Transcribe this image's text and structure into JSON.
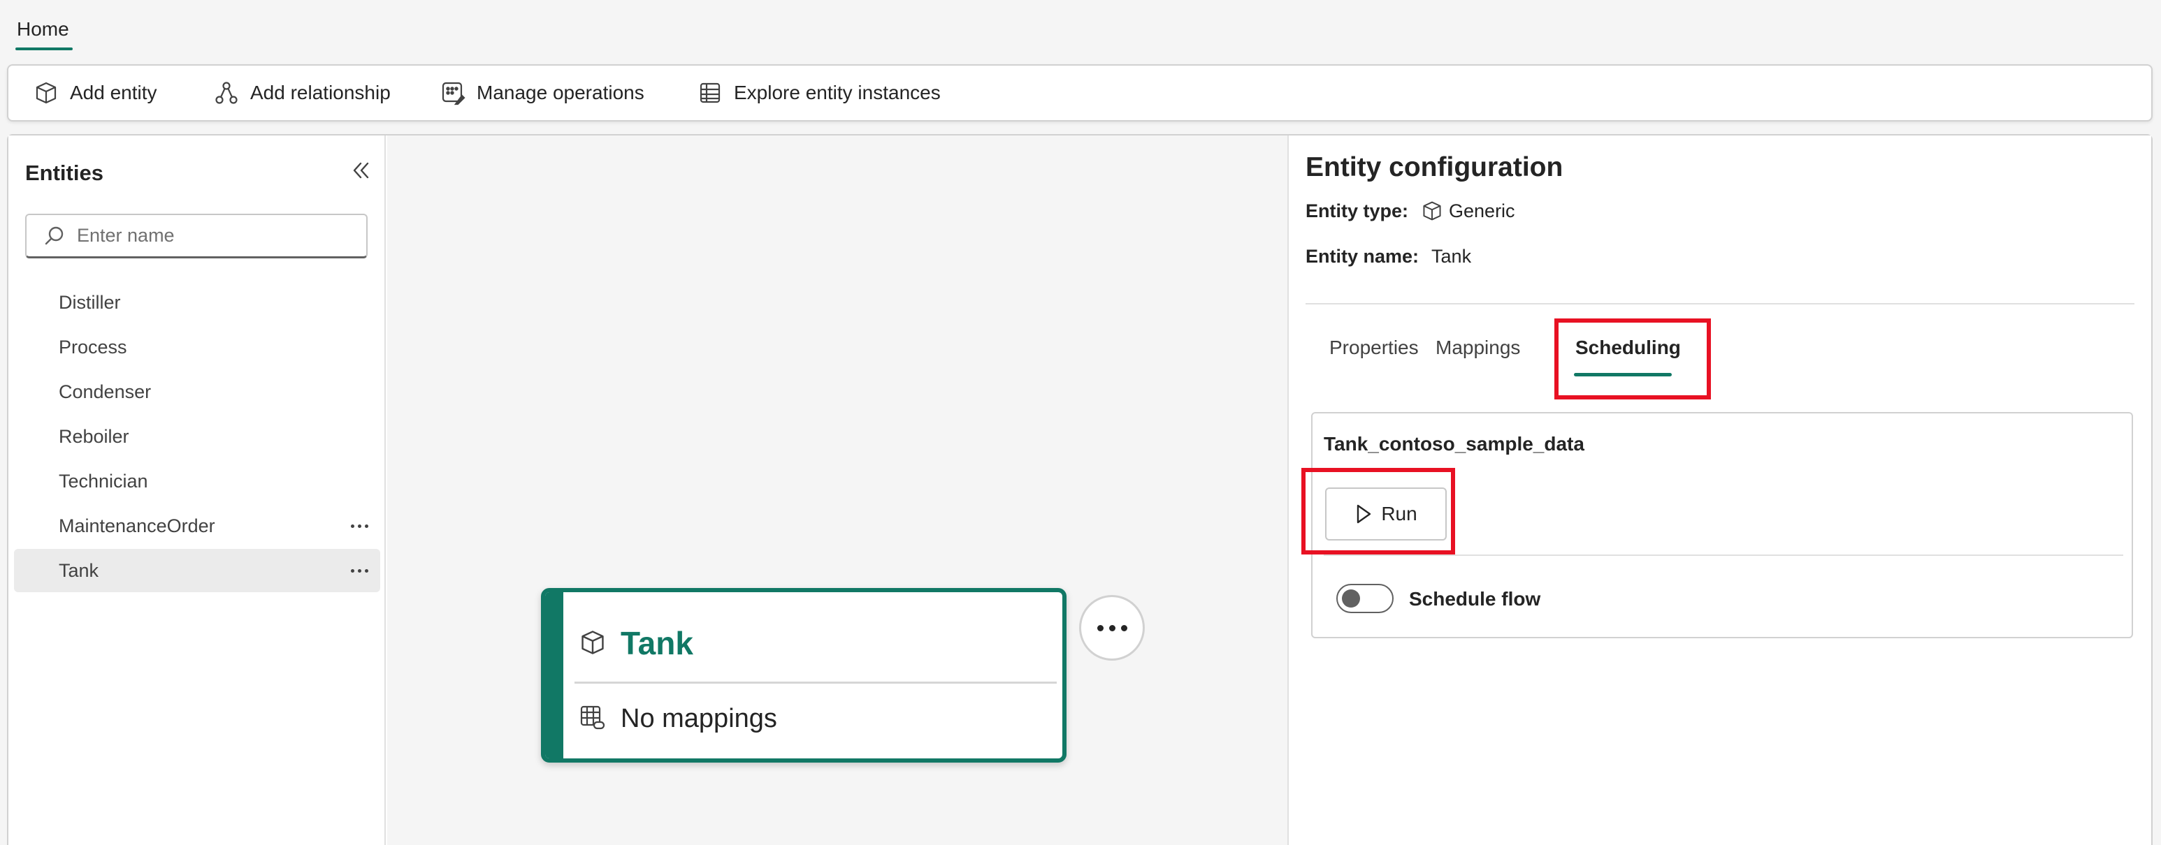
{
  "ribbon": {
    "active_tab": "Home"
  },
  "toolbar": {
    "add_entity": "Add entity",
    "add_relationship": "Add relationship",
    "manage_operations": "Manage operations",
    "explore_entity_instances": "Explore entity instances"
  },
  "sidebar": {
    "title": "Entities",
    "search_placeholder": "Enter name",
    "items": [
      {
        "label": "Distiller"
      },
      {
        "label": "Process"
      },
      {
        "label": "Condenser"
      },
      {
        "label": "Reboiler"
      },
      {
        "label": "Technician"
      },
      {
        "label": "MaintenanceOrder"
      },
      {
        "label": "Tank"
      }
    ],
    "selected": "Tank"
  },
  "canvas": {
    "node": {
      "title": "Tank",
      "mappings_text": "No mappings"
    }
  },
  "config": {
    "title": "Entity configuration",
    "entity_type_label": "Entity type:",
    "entity_type_value": "Generic",
    "entity_name_label": "Entity name:",
    "entity_name_value": "Tank",
    "tabs": [
      {
        "label": "Properties"
      },
      {
        "label": "Mappings"
      },
      {
        "label": "Scheduling"
      }
    ],
    "active_tab": "Scheduling",
    "schedule": {
      "source_name": "Tank_contoso_sample_data",
      "run_label": "Run",
      "toggle_label": "Schedule flow",
      "toggle_on": false
    }
  },
  "colors": {
    "accent": "#117865",
    "highlight": "#e81123"
  }
}
